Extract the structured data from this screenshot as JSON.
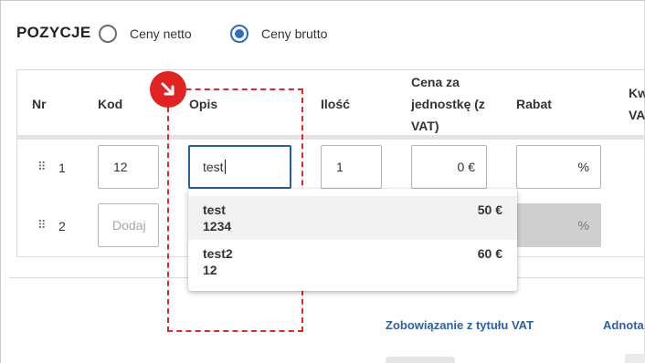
{
  "section": {
    "title": "POZYCJE"
  },
  "price_mode": {
    "options": [
      {
        "label": "Ceny netto",
        "selected": false
      },
      {
        "label": "Ceny brutto",
        "selected": true
      }
    ]
  },
  "table": {
    "columns": {
      "nr": "Nr",
      "kod": "Kod",
      "opis": "Opis",
      "ilosc": "Ilość",
      "cena_l1": "Cena za",
      "cena_l2": "jednostkę (z",
      "cena_l3": "VAT)",
      "rabat": "Rabat",
      "kw_l1": "Kw",
      "kw_l2": "VA"
    },
    "rows": [
      {
        "nr": "1",
        "kod": "12",
        "opis": "test",
        "ilosc": "1",
        "cena": "0 €",
        "rabat": "%"
      },
      {
        "nr": "2",
        "kod_placeholder": "Dodaj",
        "rabat": "%"
      }
    ]
  },
  "suggestions": [
    {
      "name": "test",
      "code": "1234",
      "price": "50 €"
    },
    {
      "name": "test2",
      "code": "12",
      "price": "60 €"
    }
  ],
  "links": {
    "vat": "Zobowiązanie z tytułu VAT",
    "notes": "Adnota"
  },
  "colors": {
    "accent": "#2f6db5",
    "annotation": "#d72b2b",
    "link": "#2f5f9e"
  },
  "icons": {
    "drag": "drag-handle-icon",
    "badge": "arrow-down-right-icon"
  }
}
